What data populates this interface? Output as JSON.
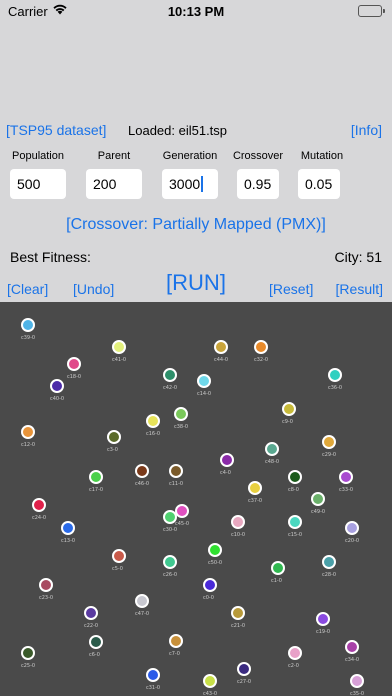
{
  "status": {
    "carrier": "Carrier",
    "time": "10:13 PM"
  },
  "toolbar": {
    "dataset_link": "[TSP95 dataset]",
    "loaded_label": "Loaded: eil51.tsp",
    "info_link": "[Info]"
  },
  "params": {
    "population": {
      "label": "Population",
      "value": "500"
    },
    "parent": {
      "label": "Parent",
      "value": "200"
    },
    "generation": {
      "label": "Generation",
      "value": "3000"
    },
    "crossover": {
      "label": "Crossover",
      "value": "0.95"
    },
    "mutation": {
      "label": "Mutation",
      "value": "0.05"
    }
  },
  "crossover_method": "[Crossover: Partially Mapped (PMX)]",
  "stats": {
    "best_fitness": "Best Fitness:",
    "city": "City: 51"
  },
  "actions": {
    "clear": "[Clear]",
    "undo": "[Undo]",
    "run": "[RUN]",
    "reset": "[Reset]",
    "result": "[Result]"
  },
  "cities": [
    {
      "label": "c39-0",
      "color": "#4fb3e6"
    },
    {
      "label": "c41-0",
      "color": "#e3f07c"
    },
    {
      "label": "c44-0",
      "color": "#c9a43a"
    },
    {
      "label": "c32-0",
      "color": "#e88a2a"
    },
    {
      "label": "c18-0",
      "color": "#e04a8a"
    },
    {
      "label": "c40-0",
      "color": "#4b2aa8"
    },
    {
      "label": "c42-0",
      "color": "#2e8f6a"
    },
    {
      "label": "c14-0",
      "color": "#6fd8ea"
    },
    {
      "label": "c36-0",
      "color": "#2fd0c0"
    },
    {
      "label": "c9-0",
      "color": "#c7ba3a"
    },
    {
      "label": "c12-0",
      "color": "#e8943a"
    },
    {
      "label": "c16-0",
      "color": "#e8e45a"
    },
    {
      "label": "c38-0",
      "color": "#7ac85a"
    },
    {
      "label": "c3-0",
      "color": "#5a6a2a"
    },
    {
      "label": "c48-0",
      "color": "#5aa890"
    },
    {
      "label": "c29-0",
      "color": "#e0a83a"
    },
    {
      "label": "c4-0",
      "color": "#8a2aa8"
    },
    {
      "label": "c17-0",
      "color": "#4ad04a"
    },
    {
      "label": "c46-0",
      "color": "#7a3a1a"
    },
    {
      "label": "c11-0",
      "color": "#7a5a2a"
    },
    {
      "label": "c8-0",
      "color": "#1a5a1a"
    },
    {
      "label": "c33-0",
      "color": "#a84ad0"
    },
    {
      "label": "c24-0",
      "color": "#e0204a"
    },
    {
      "label": "c37-0",
      "color": "#e8d040"
    },
    {
      "label": "c49-0",
      "color": "#6ab06a"
    },
    {
      "label": "c45-0",
      "color": "#e050c0"
    },
    {
      "label": "c13-0",
      "color": "#2a6ae8"
    },
    {
      "label": "c10-0",
      "color": "#e8a8c0"
    },
    {
      "label": "c15-0",
      "color": "#4ad8c0"
    },
    {
      "label": "c20-0",
      "color": "#a8a0e0"
    },
    {
      "label": "c5-0",
      "color": "#c85a4a"
    },
    {
      "label": "c26-0",
      "color": "#40c890"
    },
    {
      "label": "c50-0",
      "color": "#30e030"
    },
    {
      "label": "c1-0",
      "color": "#30b850"
    },
    {
      "label": "c28-0",
      "color": "#4aa0a8"
    },
    {
      "label": "c23-0",
      "color": "#a84a60"
    },
    {
      "label": "c0-0",
      "color": "#4a2ad8"
    },
    {
      "label": "c47-0",
      "color": "#c8c8d0"
    },
    {
      "label": "c22-0",
      "color": "#5a3aa0"
    },
    {
      "label": "c21-0",
      "color": "#b89a3a"
    },
    {
      "label": "c19-0",
      "color": "#8a4ae0"
    },
    {
      "label": "c6-0",
      "color": "#2a5a4a"
    },
    {
      "label": "c7-0",
      "color": "#c8903a"
    },
    {
      "label": "c2-0",
      "color": "#e8a0c8"
    },
    {
      "label": "c34-0",
      "color": "#a840a8"
    },
    {
      "label": "c25-0",
      "color": "#3a5a2a"
    },
    {
      "label": "c31-0",
      "color": "#2a5ae8"
    },
    {
      "label": "c27-0",
      "color": "#3a2a80"
    },
    {
      "label": "c43-0",
      "color": "#c8e048"
    },
    {
      "label": "c35-0",
      "color": "#d8a0d8"
    },
    {
      "label": "c30-0",
      "color": "#50d070"
    }
  ]
}
